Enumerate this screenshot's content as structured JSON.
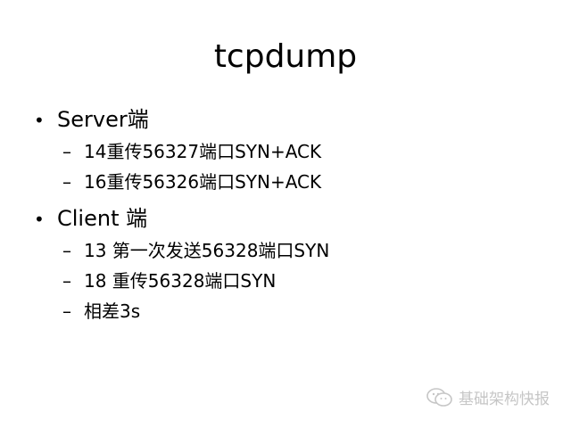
{
  "slide": {
    "title": "tcpdump",
    "groups": [
      {
        "bullet": "•",
        "label": "Server端",
        "items": [
          {
            "dash": "–",
            "text": "14重传56327端口SYN+ACK"
          },
          {
            "dash": "–",
            "text": "16重传56326端口SYN+ACK"
          }
        ]
      },
      {
        "bullet": "•",
        "label": "Client 端",
        "items": [
          {
            "dash": "–",
            "text": "13 第一次发送56328端口SYN"
          },
          {
            "dash": "–",
            "text": "18 重传56328端口SYN"
          },
          {
            "dash": "–",
            "text": "相差3s"
          }
        ]
      }
    ]
  },
  "watermark": {
    "icon": "wechat-icon",
    "text": "基础架构快报"
  }
}
